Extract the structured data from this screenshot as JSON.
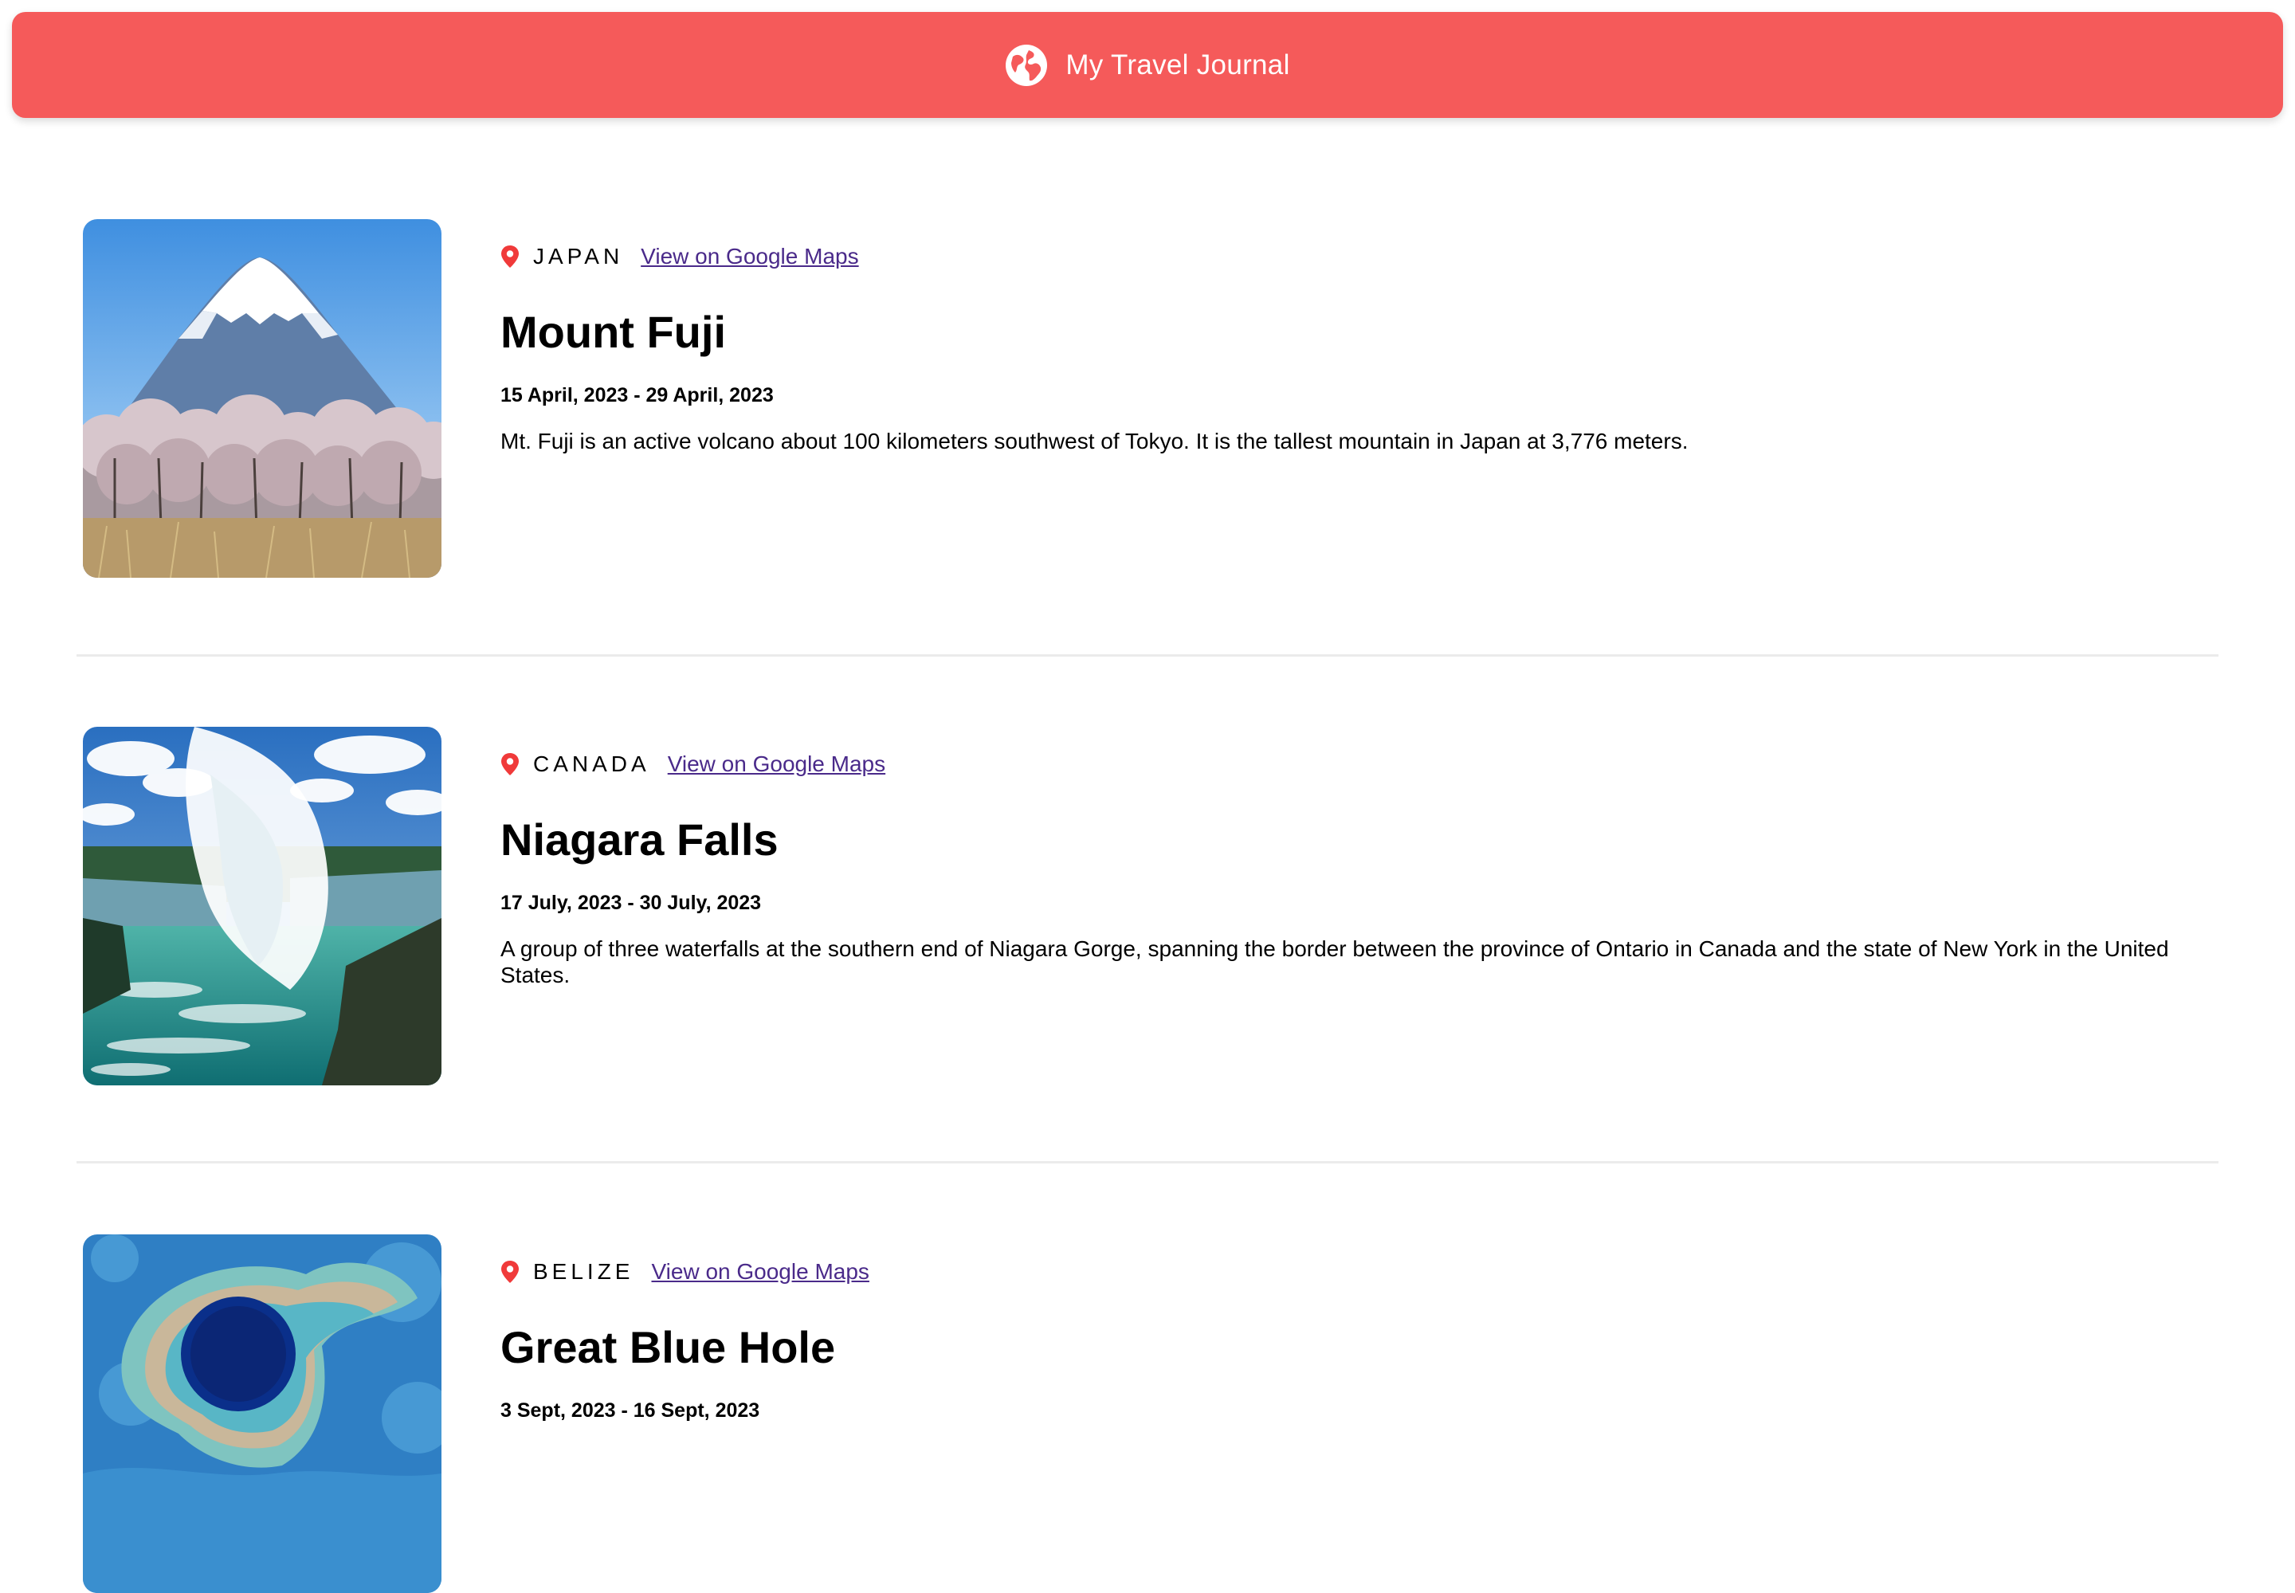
{
  "header": {
    "title": "My Travel Journal",
    "icon": "globe-icon",
    "background": "#F55A5A"
  },
  "entries": [
    {
      "country": "JAPAN",
      "map_link": "View on Google Maps",
      "title": "Mount Fuji",
      "dates": "15 April, 2023 - 29 April, 2023",
      "description": "Mt. Fuji is an active volcano about 100 kilometers southwest of Tokyo. It is the tallest mountain in Japan at 3,776 meters.",
      "image": "mount-fuji-photo"
    },
    {
      "country": "CANADA",
      "map_link": "View on Google Maps",
      "title": "Niagara Falls",
      "dates": "17 July, 2023 - 30 July, 2023",
      "description": "A group of three waterfalls at the southern end of Niagara Gorge, spanning the border between the province of Ontario in Canada and the state of New York in the United States.",
      "image": "niagara-falls-photo"
    },
    {
      "country": "BELIZE",
      "map_link": "View on Google Maps",
      "title": "Great Blue Hole",
      "dates": "3 Sept, 2023 - 16 Sept, 2023",
      "image": "great-blue-hole-photo"
    }
  ],
  "colors": {
    "accent": "#F55A5A",
    "pin": "#F03A3A",
    "link": "#4A2A8A"
  }
}
